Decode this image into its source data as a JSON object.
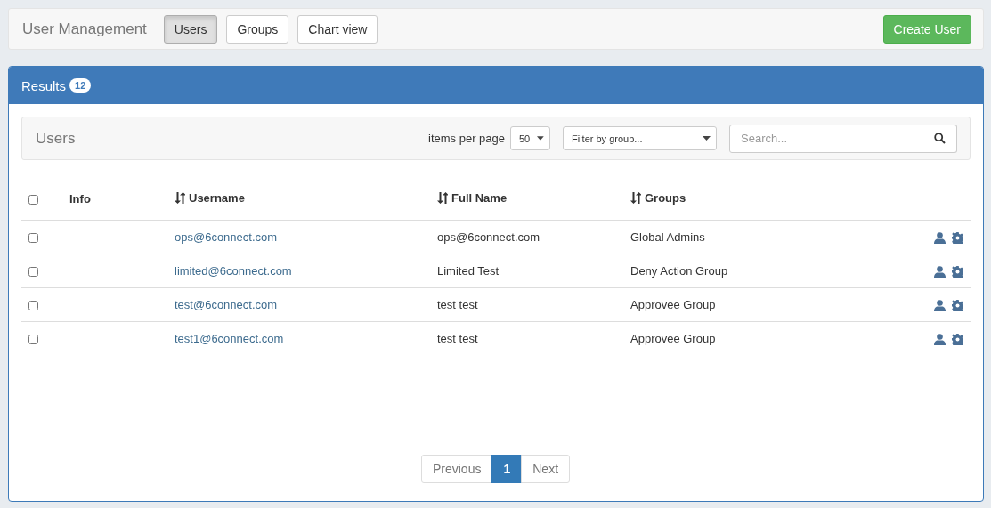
{
  "header": {
    "title": "User Management",
    "tabs": [
      {
        "label": "Users",
        "selected": true
      },
      {
        "label": "Groups",
        "selected": false
      },
      {
        "label": "Chart view",
        "selected": false
      }
    ],
    "create_button": "Create User"
  },
  "results": {
    "title": "Results",
    "count": "12",
    "toolbar": {
      "title": "Users",
      "per_page_label": "items per page",
      "per_page": "50",
      "group_filter": "Filter by group...",
      "search": {
        "placeholder": "Search..."
      }
    },
    "table": {
      "select_all_checked": false,
      "columns": [
        {
          "label": "Info",
          "sortable": false
        },
        {
          "label": "Username",
          "sortable": true
        },
        {
          "label": "Full Name",
          "sortable": true
        },
        {
          "label": "Groups",
          "sortable": true
        }
      ],
      "rows": [
        {
          "checked": false,
          "username": "ops@6connect.com",
          "full_name": "ops@6connect.com",
          "groups": "Global Admins"
        },
        {
          "checked": false,
          "username": "limited@6connect.com",
          "full_name": "Limited Test",
          "groups": "Deny Action Group"
        },
        {
          "checked": false,
          "username": "test@6connect.com",
          "full_name": "test test",
          "groups": "Approvee Group"
        },
        {
          "checked": false,
          "username": "test1@6connect.com",
          "full_name": "test test",
          "groups": "Approvee Group"
        }
      ]
    },
    "pagination": {
      "previous": "Previous",
      "pages": [
        {
          "label": "1",
          "selected": true
        }
      ],
      "next": "Next"
    }
  }
}
